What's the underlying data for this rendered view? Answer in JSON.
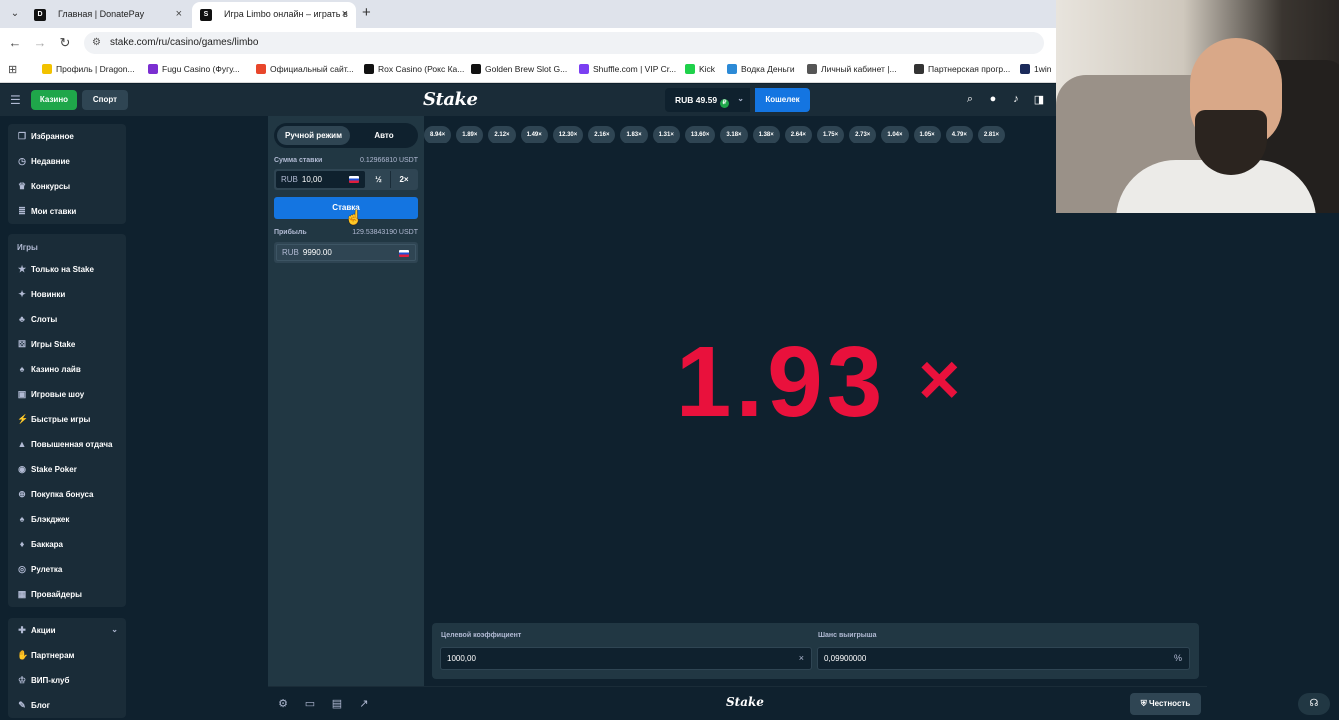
{
  "browser": {
    "tabs": [
      {
        "favicon": "D",
        "title": "Главная | DonatePay",
        "active": false
      },
      {
        "favicon": "S",
        "title": "Игра Limbo онлайн – играть в",
        "active": true
      }
    ],
    "url": "stake.com/ru/casino/games/limbo",
    "bookmarks": [
      {
        "label": "Профиль | Dragon...",
        "color": "#f2c200"
      },
      {
        "label": "Fugu Casino (Фугу...",
        "color": "#7b2fd1"
      },
      {
        "label": "Официальный сайт...",
        "color": "#e8462b"
      },
      {
        "label": "Rox Casino (Рокс Ка...",
        "color": "#111111"
      },
      {
        "label": "Golden Brew Slot G...",
        "color": "#111111"
      },
      {
        "label": "Shuffle.com | VIP Cr...",
        "color": "#7b3ff2"
      },
      {
        "label": "Kick",
        "color": "#1fd14a"
      },
      {
        "label": "Водка Деньги",
        "color": "#2c8ad6"
      },
      {
        "label": "Личный кабинет |...",
        "color": "#555555"
      },
      {
        "label": "Партнерская прогр...",
        "color": "#333333"
      },
      {
        "label": "1win",
        "color": "#1b2a5a"
      }
    ]
  },
  "header": {
    "casino_label": "Казино",
    "sport_label": "Спорт",
    "logo": "Stake",
    "balance": "RUB 49.59",
    "wallet_label": "Кошелек"
  },
  "sidebar": {
    "top_items": [
      {
        "label": "Избранное",
        "icon": "bookmark-icon"
      },
      {
        "label": "Недавние",
        "icon": "clock-icon"
      },
      {
        "label": "Конкурсы",
        "icon": "trophy-icon"
      },
      {
        "label": "Мои ставки",
        "icon": "list-icon"
      }
    ],
    "games_heading": "Игры",
    "game_items": [
      {
        "label": "Только на Stake",
        "icon": "star-icon"
      },
      {
        "label": "Новинки",
        "icon": "sparkle-icon"
      },
      {
        "label": "Слоты",
        "icon": "cherry-icon"
      },
      {
        "label": "Игры Stake",
        "icon": "dice-icon"
      },
      {
        "label": "Казино лайв",
        "icon": "cards-icon"
      },
      {
        "label": "Игровые шоу",
        "icon": "tv-icon"
      },
      {
        "label": "Быстрые игры",
        "icon": "bolt-icon"
      },
      {
        "label": "Повышенная отдача",
        "icon": "chart-icon"
      },
      {
        "label": "Stake Poker",
        "icon": "chip-icon"
      },
      {
        "label": "Покупка бонуса",
        "icon": "cart-icon"
      },
      {
        "label": "Блэкджек",
        "icon": "spade-icon"
      },
      {
        "label": "Баккара",
        "icon": "diamond-icon"
      },
      {
        "label": "Рулетка",
        "icon": "roulette-icon"
      },
      {
        "label": "Провайдеры",
        "icon": "briefcase-icon"
      }
    ],
    "bottom_items": [
      {
        "label": "Акции",
        "icon": "gift-icon"
      },
      {
        "label": "Партнерам",
        "icon": "handshake-icon"
      },
      {
        "label": "ВИП-клуб",
        "icon": "crown-icon"
      },
      {
        "label": "Блог",
        "icon": "pen-icon"
      }
    ]
  },
  "bet_panel": {
    "manual_label": "Ручной режим",
    "auto_label": "Авто",
    "bet_amount_label": "Сумма ставки",
    "bet_amount_usdt": "0.12966810 USDT",
    "currency": "RUB",
    "bet_amount": "10,00",
    "half_label": "½",
    "double_label": "2×",
    "bet_button": "Ставка",
    "profit_label": "Прибыль",
    "profit_usdt": "129.53843190 USDT",
    "profit_value": "9990.00"
  },
  "history": [
    "8.94×",
    "1.89×",
    "2.12×",
    "1.49×",
    "12.30×",
    "2.16×",
    "1.83×",
    "1.31×",
    "13.60×",
    "3.18×",
    "1.38×",
    "2.64×",
    "1.75×",
    "2.73×",
    "1.04×",
    "1.05×",
    "4.79×",
    "2.81×"
  ],
  "result": {
    "value": "1.93",
    "suffix": "×",
    "color": "#e9113c"
  },
  "controls": {
    "target_label": "Целевой коэффициент",
    "target_value": "1000,00",
    "chance_label": "Шанс выигрыша",
    "chance_value": "0,09900000",
    "chance_suffix": "%"
  },
  "footer": {
    "logo": "Stake",
    "fairness_label": "Честность"
  },
  "colors": {
    "accent_green": "#1fa64a",
    "accent_blue": "#1475e1",
    "bg_dark": "#0f212e",
    "panel": "#213743"
  }
}
